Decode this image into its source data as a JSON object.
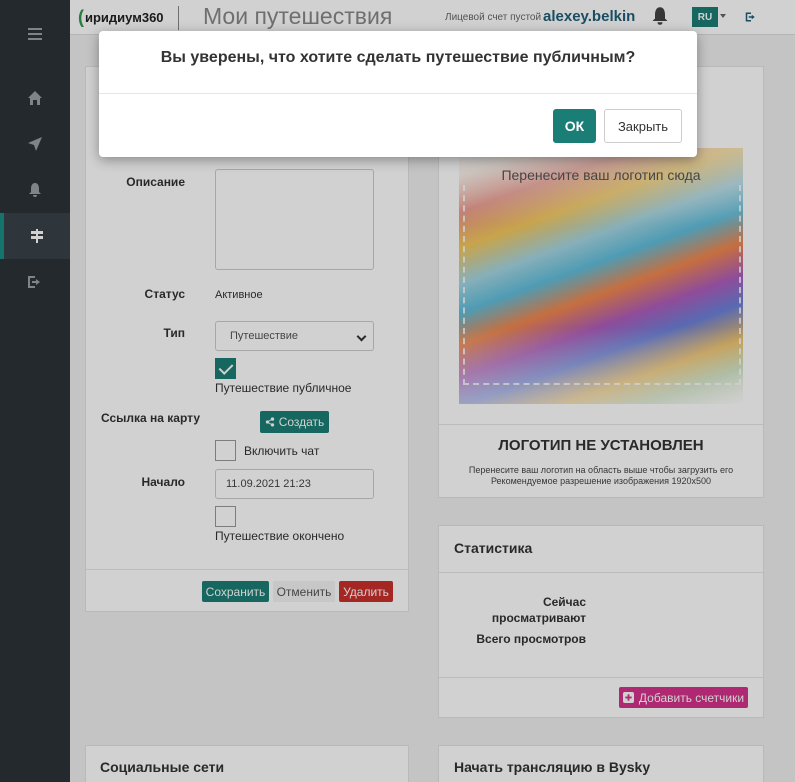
{
  "header": {
    "logo_text": "иридиум360",
    "page_title": "Мои путешествия",
    "account_status": "Лицевой счет пустой",
    "username": "alexey.belkin",
    "language": "RU"
  },
  "sidebar": {
    "items": [
      {
        "icon": "menu-icon"
      },
      {
        "icon": "home-icon"
      },
      {
        "icon": "navigation-icon"
      },
      {
        "icon": "bell-icon"
      },
      {
        "icon": "signpost-icon",
        "active": true
      },
      {
        "icon": "logout-icon"
      }
    ]
  },
  "trip_form": {
    "description_label": "Описание",
    "description_value": "",
    "status_label": "Статус",
    "status_value": "Активное",
    "type_label": "Тип",
    "type_value": "Путешествие",
    "public_checked": true,
    "public_label": "Путешествие публичное",
    "map_link_label": "Ссылка на карту",
    "create_button": "Создать",
    "chat_checked": false,
    "chat_label": "Включить чат",
    "start_label": "Начало",
    "start_value": "11.09.2021 21:23",
    "finished_checked": false,
    "finished_label": "Путешествие окончено",
    "save_button": "Сохранить",
    "cancel_button": "Отменить",
    "delete_button": "Удалить"
  },
  "logo_panel": {
    "drop_text": "Перенесите ваш логотип сюда",
    "no_logo_title": "ЛОГОТИП НЕ УСТАНОВЛЕН",
    "hint_line1": "Перенесите ваш логотип на область выше чтобы загрузить его",
    "hint_line2": "Рекомендуемое разрешение изображения 1920x500"
  },
  "stats_panel": {
    "title": "Статистика",
    "watching_now_line1": "Сейчас",
    "watching_now_line2": "просматривают",
    "total_views": "Всего просмотров",
    "add_counters_button": "Добавить счетчики"
  },
  "social_panel": {
    "title": "Социальные сети"
  },
  "bysky_panel": {
    "title": "Начать трансляцию в Bysky"
  },
  "modal": {
    "title": "Вы уверены, что хотите сделать путешествие публичным?",
    "ok_button": "ОК",
    "close_button": "Закрыть"
  },
  "colors": {
    "accent": "#1a7e76",
    "sidebar": "#2d3338",
    "danger": "#c9302c",
    "pink": "#d6338c",
    "username": "#1f5f7a"
  }
}
